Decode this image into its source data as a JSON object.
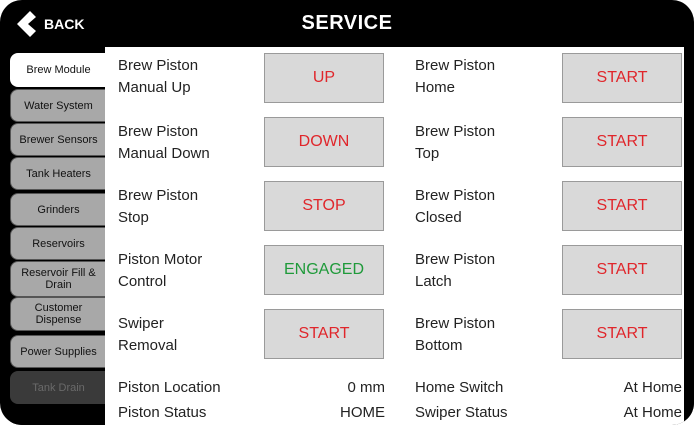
{
  "header": {
    "back_label": "BACK",
    "title": "SERVICE"
  },
  "sidebar": {
    "tabs": [
      {
        "label": "Brew Module",
        "active": true
      },
      {
        "label": "Water System"
      },
      {
        "label": "Brewer Sensors"
      },
      {
        "label": "Tank Heaters"
      },
      {
        "label": "Grinders"
      },
      {
        "label": "Reservoirs"
      },
      {
        "label": "Reservoir Fill & Drain"
      },
      {
        "label": "Customer Dispense"
      },
      {
        "label": "Power Supplies"
      },
      {
        "label": "Tank Drain",
        "faded": true
      }
    ]
  },
  "controls_left": [
    {
      "label_line1": "Brew Piston",
      "label_line2": "Manual Up",
      "button": "UP",
      "color": "#e0262b"
    },
    {
      "label_line1": "Brew Piston",
      "label_line2": "Manual Down",
      "button": "DOWN",
      "color": "#e0262b"
    },
    {
      "label_line1": "Brew Piston",
      "label_line2": "Stop",
      "button": "STOP",
      "color": "#e0262b"
    },
    {
      "label_line1": "Piston Motor",
      "label_line2": "Control",
      "button": "ENGAGED",
      "color": "#1f9a3a"
    },
    {
      "label_line1": "Swiper",
      "label_line2": "Removal",
      "button": "START",
      "color": "#e0262b"
    }
  ],
  "controls_right": [
    {
      "label_line1": "Brew Piston",
      "label_line2": "Home",
      "button": "START"
    },
    {
      "label_line1": "Brew Piston",
      "label_line2": "Top",
      "button": "START"
    },
    {
      "label_line1": "Brew Piston",
      "label_line2": "Closed",
      "button": "START"
    },
    {
      "label_line1": "Brew Piston",
      "label_line2": "Latch",
      "button": "START"
    },
    {
      "label_line1": "Brew Piston",
      "label_line2": "Bottom",
      "button": "START"
    }
  ],
  "status": {
    "piston_location_label": "Piston Location",
    "piston_location_value": "0 mm",
    "piston_status_label": "Piston Status",
    "piston_status_value": "HOME",
    "home_switch_label": "Home Switch",
    "home_switch_value": "At Home",
    "swiper_status_label": "Swiper Status",
    "swiper_status_value": "At Home"
  }
}
